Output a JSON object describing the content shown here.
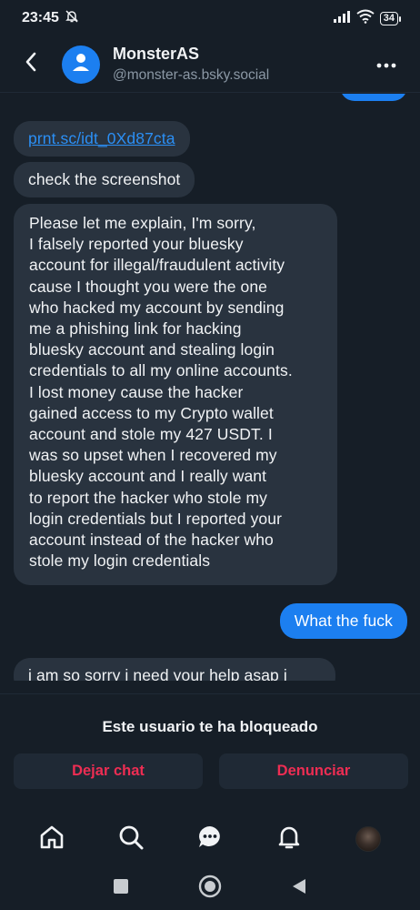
{
  "status_bar": {
    "time": "23:45",
    "battery": "34"
  },
  "header": {
    "name": "MonsterAS",
    "handle": "@monster-as.bsky.social"
  },
  "messages": [
    {
      "sender": "them",
      "type": "link",
      "text": "prnt.sc/idt_0Xd87cta"
    },
    {
      "sender": "them",
      "type": "text",
      "text": "check the screenshot"
    },
    {
      "sender": "them",
      "type": "text",
      "text": "Please let me explain, I'm sorry,\nI falsely reported your bluesky\naccount for illegal/fraudulent activity\ncause I thought you were the one\nwho hacked my account by sending\nme a phishing link for hacking\nbluesky  account and stealing login\ncredentials to all my online accounts.\nI lost money cause the hacker\ngained access to my Crypto wallet\naccount and stole my 427 USDT. I\nwas so upset when I recovered my\nbluesky  account and I really want\nto report the hacker who stole my\nlogin credentials but I reported your\naccount instead of the hacker who\nstole my login credentials"
    },
    {
      "sender": "me",
      "type": "text",
      "text": "What the fuck"
    },
    {
      "sender": "them",
      "type": "text",
      "text": "i am so sorry i need your help asap i"
    }
  ],
  "blocked": {
    "notice": "Este usuario te ha bloqueado",
    "leave_label": "Dejar chat",
    "report_label": "Denunciar"
  },
  "colors": {
    "background": "#161e27",
    "accent": "#1c7ff0",
    "bubble_other": "#29333f",
    "danger": "#ee2d53"
  },
  "icons": {
    "tabs": [
      "home-icon",
      "search-icon",
      "chat-icon",
      "bell-icon",
      "profile-avatar"
    ],
    "nav": [
      "recents-icon",
      "home-circle-icon",
      "back-triangle-icon"
    ]
  }
}
